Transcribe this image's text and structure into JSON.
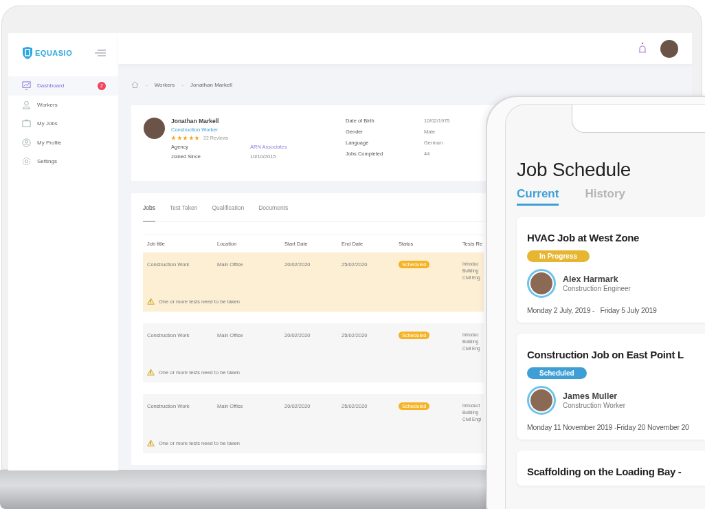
{
  "app": {
    "logo_text": "EQUASIO"
  },
  "sidebar": {
    "items": [
      {
        "label": "Dashboard",
        "selected": true,
        "badge": "2"
      },
      {
        "label": "Workers",
        "selected": false
      },
      {
        "label": "My Jobs",
        "selected": false
      },
      {
        "label": "My Profile",
        "selected": false
      },
      {
        "label": "Settings",
        "selected": false
      }
    ]
  },
  "breadcrumb": [
    {
      "kind": "home"
    },
    {
      "kind": "separator",
      "text": "-"
    },
    {
      "kind": "link",
      "text": "Workers"
    },
    {
      "kind": "separator",
      "text": "-"
    },
    {
      "kind": "current",
      "text": "Jonathan Markell"
    }
  ],
  "profile": {
    "name": "Jonathan Markell",
    "role": "Construction Worker",
    "stars": 5,
    "reviews": "22 Reviews",
    "fields": [
      {
        "label": "Agency",
        "value": "ARN Associates",
        "kind": "link"
      },
      {
        "label": "Joined Since",
        "value": "10/10/2015",
        "kind": "text"
      }
    ],
    "details": [
      {
        "label": "Date of Birth",
        "value": "10/02/1975"
      },
      {
        "label": "Gender",
        "value": "Male"
      },
      {
        "label": "Language",
        "value": "German"
      },
      {
        "label": "Jobs Completed",
        "value": "44"
      }
    ]
  },
  "tabs": [
    {
      "label": "Jobs",
      "selected": true
    },
    {
      "label": "Test Taken",
      "selected": false
    },
    {
      "label": "Qualification",
      "selected": false
    },
    {
      "label": "Documents",
      "selected": false
    }
  ],
  "table": {
    "columns": [
      "Job title",
      "Location",
      "Start Date",
      "End Date",
      "Status",
      "Tests Re"
    ],
    "rows": [
      {
        "selected": true,
        "job_title": "Construction Work",
        "location": "Main Office",
        "start_date": "20/02/2020",
        "end_date": "25/02/2020",
        "status": "Scheduled",
        "tests": [
          "Introduc",
          "Building",
          "Civil Eng"
        ],
        "warning": "One or more tests need to be taken"
      },
      {
        "selected": false,
        "job_title": "Construction Work",
        "location": "Main Office",
        "start_date": "20/02/2020",
        "end_date": "25/02/2020",
        "status": "Scheduled",
        "tests": [
          "Introduc",
          "Building",
          "Civil Eng"
        ],
        "warning": "One or more tests need to be taken"
      },
      {
        "selected": false,
        "job_title": "Construction Work",
        "location": "Main Office",
        "start_date": "20/02/2020",
        "end_date": "25/02/2020",
        "status": "Scheduled",
        "tests": [
          "Introduct",
          "Building",
          "Civil Engi"
        ],
        "warning": "One or more tests need to be taken"
      }
    ]
  },
  "phone": {
    "title": "Job Schedule",
    "tabs": [
      {
        "label": "Current",
        "selected": true
      },
      {
        "label": "History",
        "selected": false
      }
    ],
    "jobs": [
      {
        "title": "HVAC Job at West Zone",
        "status": "In Progress",
        "color": "#e6b630",
        "worker": "Alex Harmark",
        "role": "Construction Engineer",
        "dates": "Monday 2 July, 2019 -   Friday 5 July 2019"
      },
      {
        "title": "Construction Job on East Point L",
        "status": "Scheduled",
        "color": "#3d9fd5",
        "worker": "James Muller",
        "role": "Construction Worker",
        "dates": "Monday 11 November 2019 -Friday 20 November 20"
      },
      {
        "title": "Scaffolding on the Loading Bay -"
      }
    ]
  }
}
